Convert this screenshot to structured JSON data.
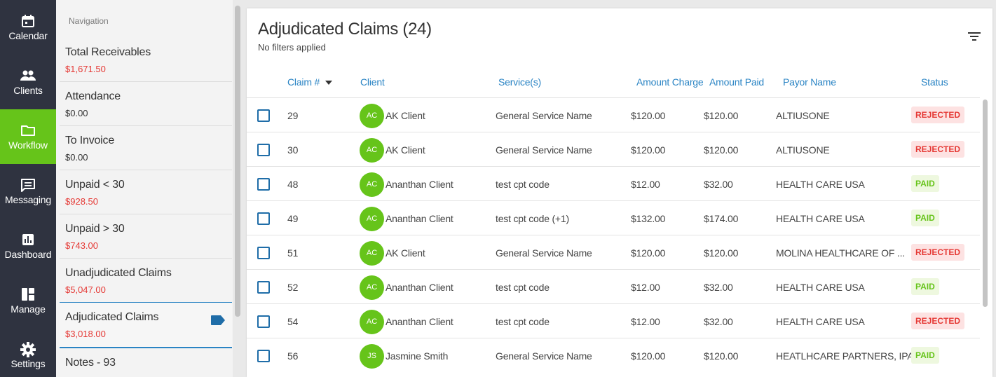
{
  "rail": {
    "items": [
      {
        "label": "Calendar"
      },
      {
        "label": "Clients"
      },
      {
        "label": "Workflow"
      },
      {
        "label": "Messaging"
      },
      {
        "label": "Dashboard"
      },
      {
        "label": "Manage"
      },
      {
        "label": "Settings"
      }
    ],
    "active": "Workflow",
    "active_color": "#66c41a"
  },
  "nav": {
    "heading": "Navigation",
    "items": [
      {
        "name": "Total Receivables",
        "amount": "$1,671.50"
      },
      {
        "name": "Attendance",
        "amount": "$0.00"
      },
      {
        "name": "To Invoice",
        "amount": "$0.00"
      },
      {
        "name": "Unpaid < 30",
        "amount": "$928.50"
      },
      {
        "name": "Unpaid > 30",
        "amount": "$743.00"
      },
      {
        "name": "Unadjudicated Claims",
        "amount": "$5,047.00"
      },
      {
        "name": "Adjudicated Claims",
        "amount": "$3,018.00"
      },
      {
        "name": "Notes - 93",
        "amount": ""
      }
    ],
    "selected": "Adjudicated Claims"
  },
  "main": {
    "title": "Adjudicated Claims (24)",
    "subtitle": "No filters applied",
    "filter_icon": "filter-list-icon",
    "columns": {
      "claim": "Claim #",
      "client": "Client",
      "services": "Service(s)",
      "amount_charge": "Amount Charge",
      "amount_paid": "Amount Paid",
      "payor": "Payor Name",
      "status": "Status"
    },
    "rows": [
      {
        "claim": "29",
        "initials": "AC",
        "client": "AK Client",
        "service": "General Service Name",
        "charge": "$120.00",
        "paid": "$120.00",
        "payor": "ALTIUSONE",
        "status": "REJECTED"
      },
      {
        "claim": "30",
        "initials": "AC",
        "client": "AK Client",
        "service": "General Service Name",
        "charge": "$120.00",
        "paid": "$120.00",
        "payor": "ALTIUSONE",
        "status": "REJECTED"
      },
      {
        "claim": "48",
        "initials": "AC",
        "client": "Ananthan Client",
        "service": "test cpt code",
        "charge": "$12.00",
        "paid": "$32.00",
        "payor": "HEALTH CARE USA",
        "status": "PAID"
      },
      {
        "claim": "49",
        "initials": "AC",
        "client": "Ananthan Client",
        "service": "test cpt code (+1)",
        "charge": "$132.00",
        "paid": "$174.00",
        "payor": "HEALTH CARE USA",
        "status": "PAID"
      },
      {
        "claim": "51",
        "initials": "AC",
        "client": "AK Client",
        "service": "General Service Name",
        "charge": "$120.00",
        "paid": "$120.00",
        "payor": "MOLINA HEALTHCARE OF ...",
        "status": "REJECTED"
      },
      {
        "claim": "52",
        "initials": "AC",
        "client": "Ananthan Client",
        "service": "test cpt code",
        "charge": "$12.00",
        "paid": "$32.00",
        "payor": "HEALTH CARE USA",
        "status": "PAID"
      },
      {
        "claim": "54",
        "initials": "AC",
        "client": "Ananthan Client",
        "service": "test cpt code",
        "charge": "$12.00",
        "paid": "$32.00",
        "payor": "HEALTH CARE USA",
        "status": "REJECTED"
      },
      {
        "claim": "56",
        "initials": "JS",
        "client": "Jasmine Smith",
        "service": "General Service Name",
        "charge": "$120.00",
        "paid": "$120.00",
        "payor": "HEATLHCARE PARTNERS, IPA",
        "status": "PAID"
      }
    ]
  },
  "colors": {
    "rail_bg": "#2f3340",
    "accent_green": "#66c41a",
    "link_blue": "#2a84c4",
    "rejected_red": "#e53935"
  }
}
